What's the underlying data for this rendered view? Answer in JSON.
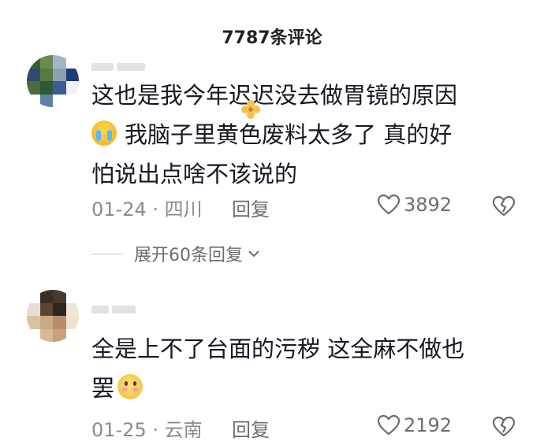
{
  "header": {
    "title": "7787条评论"
  },
  "comments": [
    {
      "content_line1": "这也是我今年迟迟没去做胃镜的原因",
      "content_line2": "我脑子里黄色废料太多了 真的好",
      "content_line3": "怕说出点啥不该说的",
      "date_location": "01-24 · 四川",
      "reply_label": "回复",
      "likes": "3892",
      "emoji_icon": "loudly-crying-face",
      "avatar_colors": [
        "#3b5a3a",
        "#6a8a4e",
        "#9fb8c8",
        "#ffffff",
        "#2f4b6e",
        "#587a42",
        "#8aa0b5",
        "#1d3a7a",
        "#4b6a3f",
        "#2c5a34",
        "#3a5a9a",
        "#f2f2f2",
        "#ffffff",
        "#5d7fa8",
        "#ffffff",
        "#ffffff"
      ]
    },
    {
      "content_line1": "全是上不了台面的污秽 这全麻不做也",
      "content_line2": "罢",
      "date_location": "01-25 · 云南",
      "reply_label": "回复",
      "likes": "2192",
      "emoji_icon": "flushed-shy-face",
      "avatar_colors": [
        "#ffffff",
        "#3a2f28",
        "#4a3a2e",
        "#ffffff",
        "#e8ddd0",
        "#5a4636",
        "#2f2620",
        "#f0e6d8",
        "#d9c2a4",
        "#c9a885",
        "#b88e6a",
        "#efe2d0",
        "#ffffff",
        "#d8b696",
        "#c8a07c",
        "#ffffff"
      ]
    }
  ],
  "expand": {
    "label": "展开60条回复"
  },
  "colors": {
    "text": "#161823",
    "muted": "#8a8b91",
    "accent": "#6b6c72"
  }
}
